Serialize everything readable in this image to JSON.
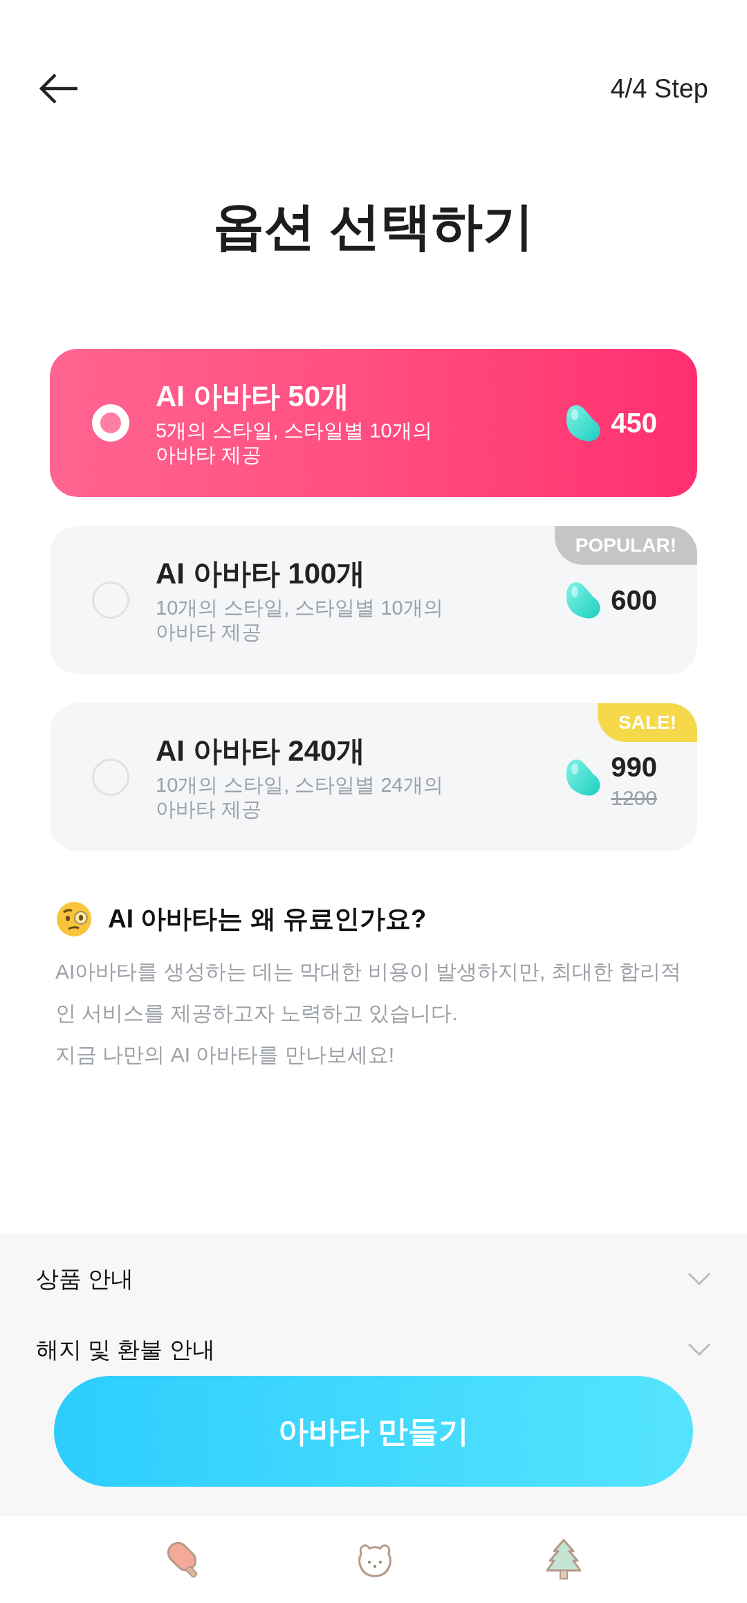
{
  "header": {
    "step": "4/4 Step"
  },
  "title": "옵션 선택하기",
  "options": [
    {
      "name": "AI 아바타 50개",
      "description": "5개의 스타일, 스타일별 10개의\n아바타 제공",
      "price": "450",
      "selected": true
    },
    {
      "name": "AI 아바타 100개",
      "description": "10개의 스타일, 스타일별 10개의\n아바타 제공",
      "price": "600",
      "selected": false,
      "badge": {
        "kind": "popular",
        "label": "POPULAR!"
      }
    },
    {
      "name": "AI 아바타 240개",
      "description": "10개의 스타일, 스타일별 24개의\n아바타 제공",
      "price": "990",
      "original_price": "1200",
      "selected": false,
      "badge": {
        "kind": "sale",
        "label": "SALE!"
      }
    }
  ],
  "info": {
    "heading": "AI 아바타는 왜 유료인가요?",
    "paragraphs": [
      "AI아바타를 생성하는 데는 막대한 비용이 발생하지만, 최대한 합리적인 서비스를 제공하고자 노력하고 있습니다.",
      "지금 나만의 AI 아바타를 만나보세요!"
    ]
  },
  "accordion": [
    {
      "label": "상품 안내",
      "expanded": false
    },
    {
      "label": "해지 및 환불 안내",
      "expanded": false
    }
  ],
  "cta": "아바타 만들기"
}
